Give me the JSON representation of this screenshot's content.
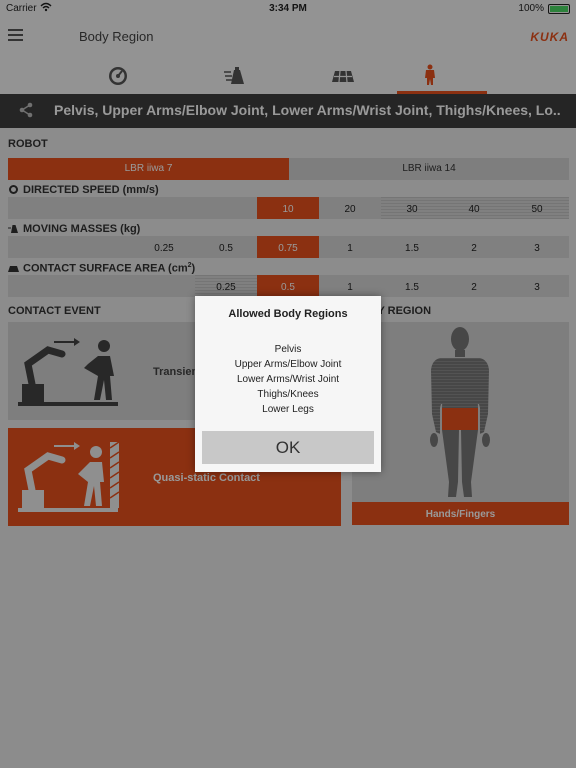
{
  "status_bar": {
    "carrier": "Carrier",
    "time": "3:34 PM",
    "battery": "100%"
  },
  "nav": {
    "title": "Body Region",
    "brand": "KUKA"
  },
  "tabs": [
    {
      "icon": "speedometer-icon",
      "active": false
    },
    {
      "icon": "mass-weight-icon",
      "active": false
    },
    {
      "icon": "contact-area-icon",
      "active": false
    },
    {
      "icon": "human-body-icon",
      "active": true
    }
  ],
  "region_header": {
    "title": "Pelvis, Upper Arms/Elbow Joint, Lower Arms/Wrist Joint, Thighs/Knees, Lo..."
  },
  "robot": {
    "label": "ROBOT",
    "options": [
      {
        "label": "LBR iiwa 7",
        "selected": true
      },
      {
        "label": "LBR iiwa 14",
        "selected": false
      }
    ]
  },
  "directed_speed": {
    "label": "DIRECTED SPEED (mm/s)",
    "values": [
      "10",
      "20",
      "30",
      "40",
      "50"
    ],
    "selected": "10"
  },
  "moving_masses": {
    "label": "MOVING MASSES (kg)",
    "values": [
      "0.25",
      "0.5",
      "0.75",
      "1",
      "1.5",
      "2",
      "3"
    ],
    "selected": "0.75"
  },
  "contact_surface": {
    "label": "CONTACT SURFACE AREA (cm",
    "label_sup": "2",
    "label_end": ")",
    "values": [
      "0.25",
      "0.5",
      "1",
      "1.5",
      "2",
      "3"
    ],
    "selected": "0.5"
  },
  "contact_event": {
    "label": "CONTACT EVENT",
    "options": [
      {
        "label": "Transient Contact",
        "selected": false
      },
      {
        "label": "Quasi-static Contact",
        "selected": true
      }
    ]
  },
  "body_region": {
    "label": "BODY REGION",
    "selected_label": "Hands/Fingers"
  },
  "dialog": {
    "title": "Allowed Body Regions",
    "items": [
      "Pelvis",
      "Upper Arms/Elbow Joint",
      "Lower Arms/Wrist Joint",
      "Thighs/Knees",
      "Lower Legs"
    ],
    "ok": "OK"
  },
  "colors": {
    "accent": "#e8501d",
    "header": "#3f3f3f",
    "panel": "#d2d2d2"
  }
}
